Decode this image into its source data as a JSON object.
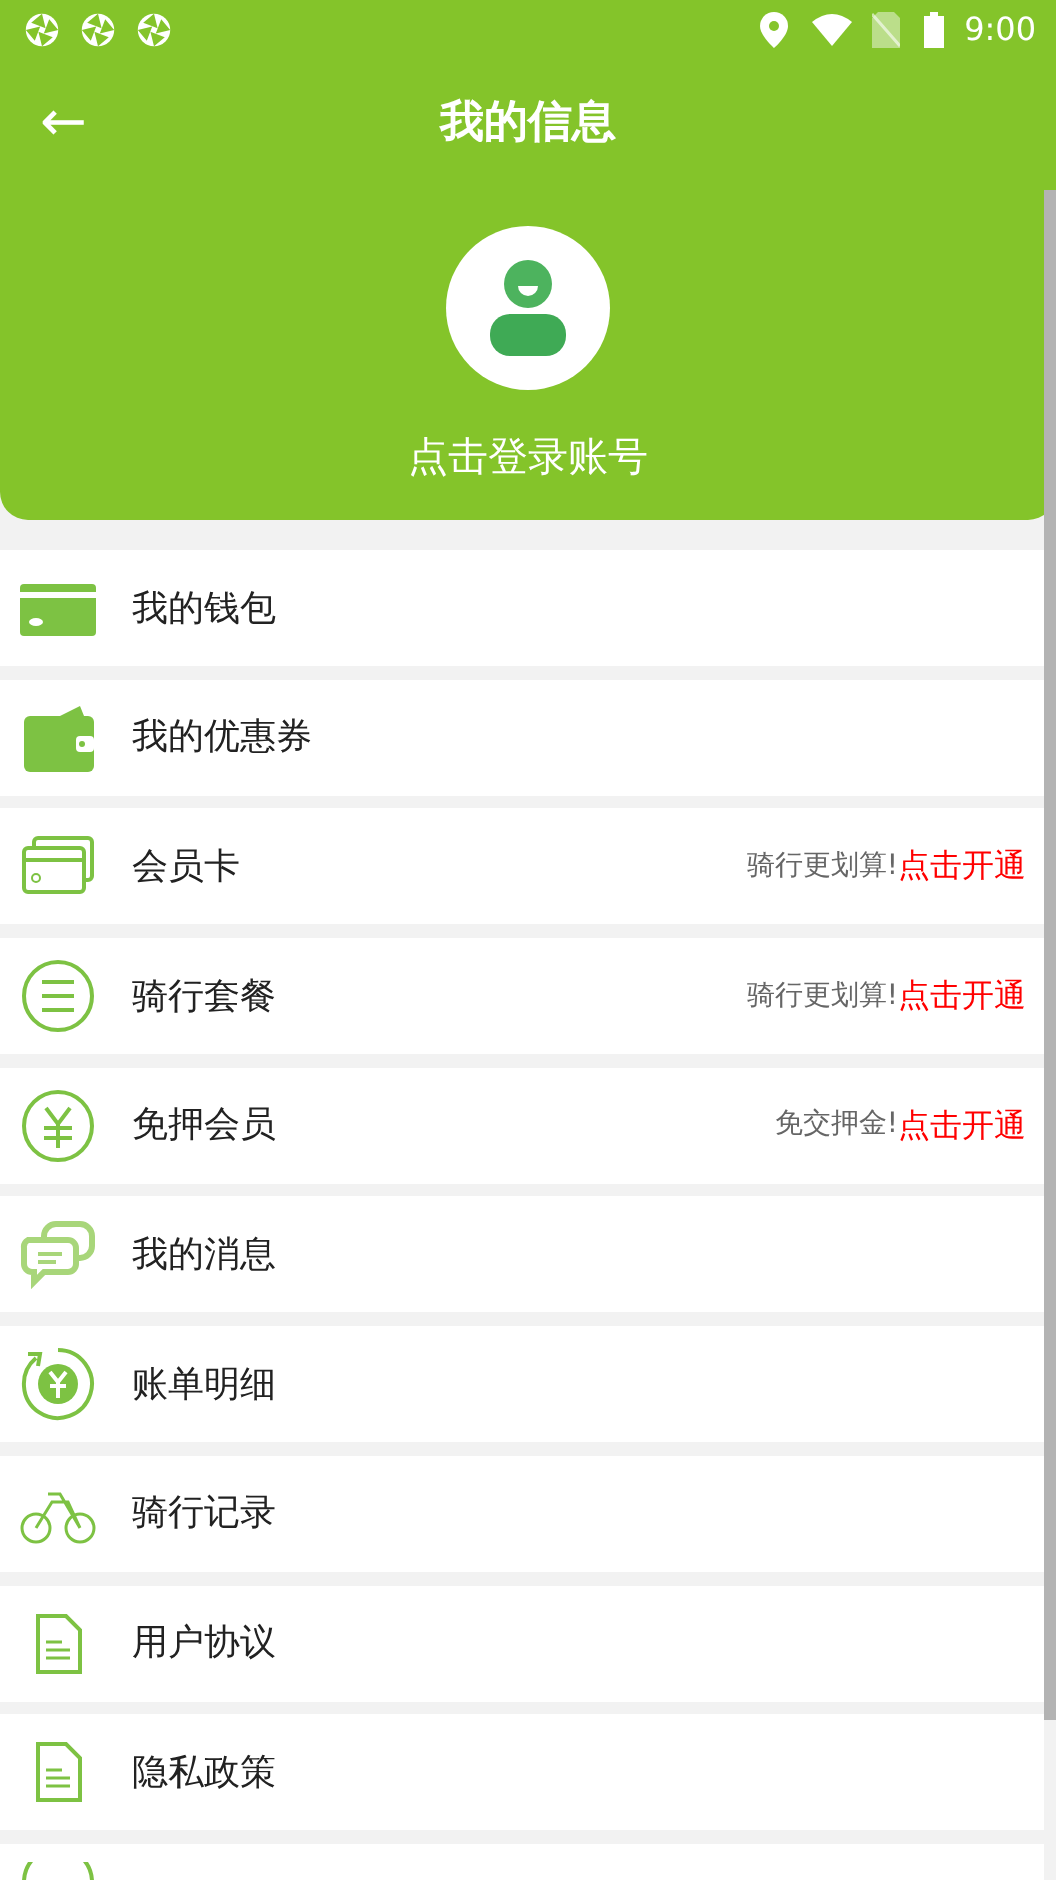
{
  "status_bar": {
    "time": "9:00"
  },
  "toolbar": {
    "back": "←",
    "title": "我的信息"
  },
  "profile": {
    "login_prompt": "点击登录账号"
  },
  "menu_items": [
    {
      "kind": "plain",
      "label": "我的钱包"
    },
    {
      "kind": "plain",
      "label": "我的优惠券"
    },
    {
      "kind": "promo",
      "label": "会员卡",
      "hint": "骑行更划算!",
      "action": "点击开通"
    },
    {
      "kind": "promo",
      "label": "骑行套餐",
      "hint": "骑行更划算!",
      "action": "点击开通"
    },
    {
      "kind": "promo",
      "label": "免押会员",
      "hint": "免交押金!",
      "action": "点击开通"
    },
    {
      "kind": "plain",
      "label": "我的消息"
    },
    {
      "kind": "plain",
      "label": "账单明细"
    },
    {
      "kind": "plain",
      "label": "骑行记录"
    },
    {
      "kind": "plain",
      "label": "用户协议"
    },
    {
      "kind": "plain",
      "label": "隐私政策"
    },
    {
      "kind": "partial"
    }
  ]
}
